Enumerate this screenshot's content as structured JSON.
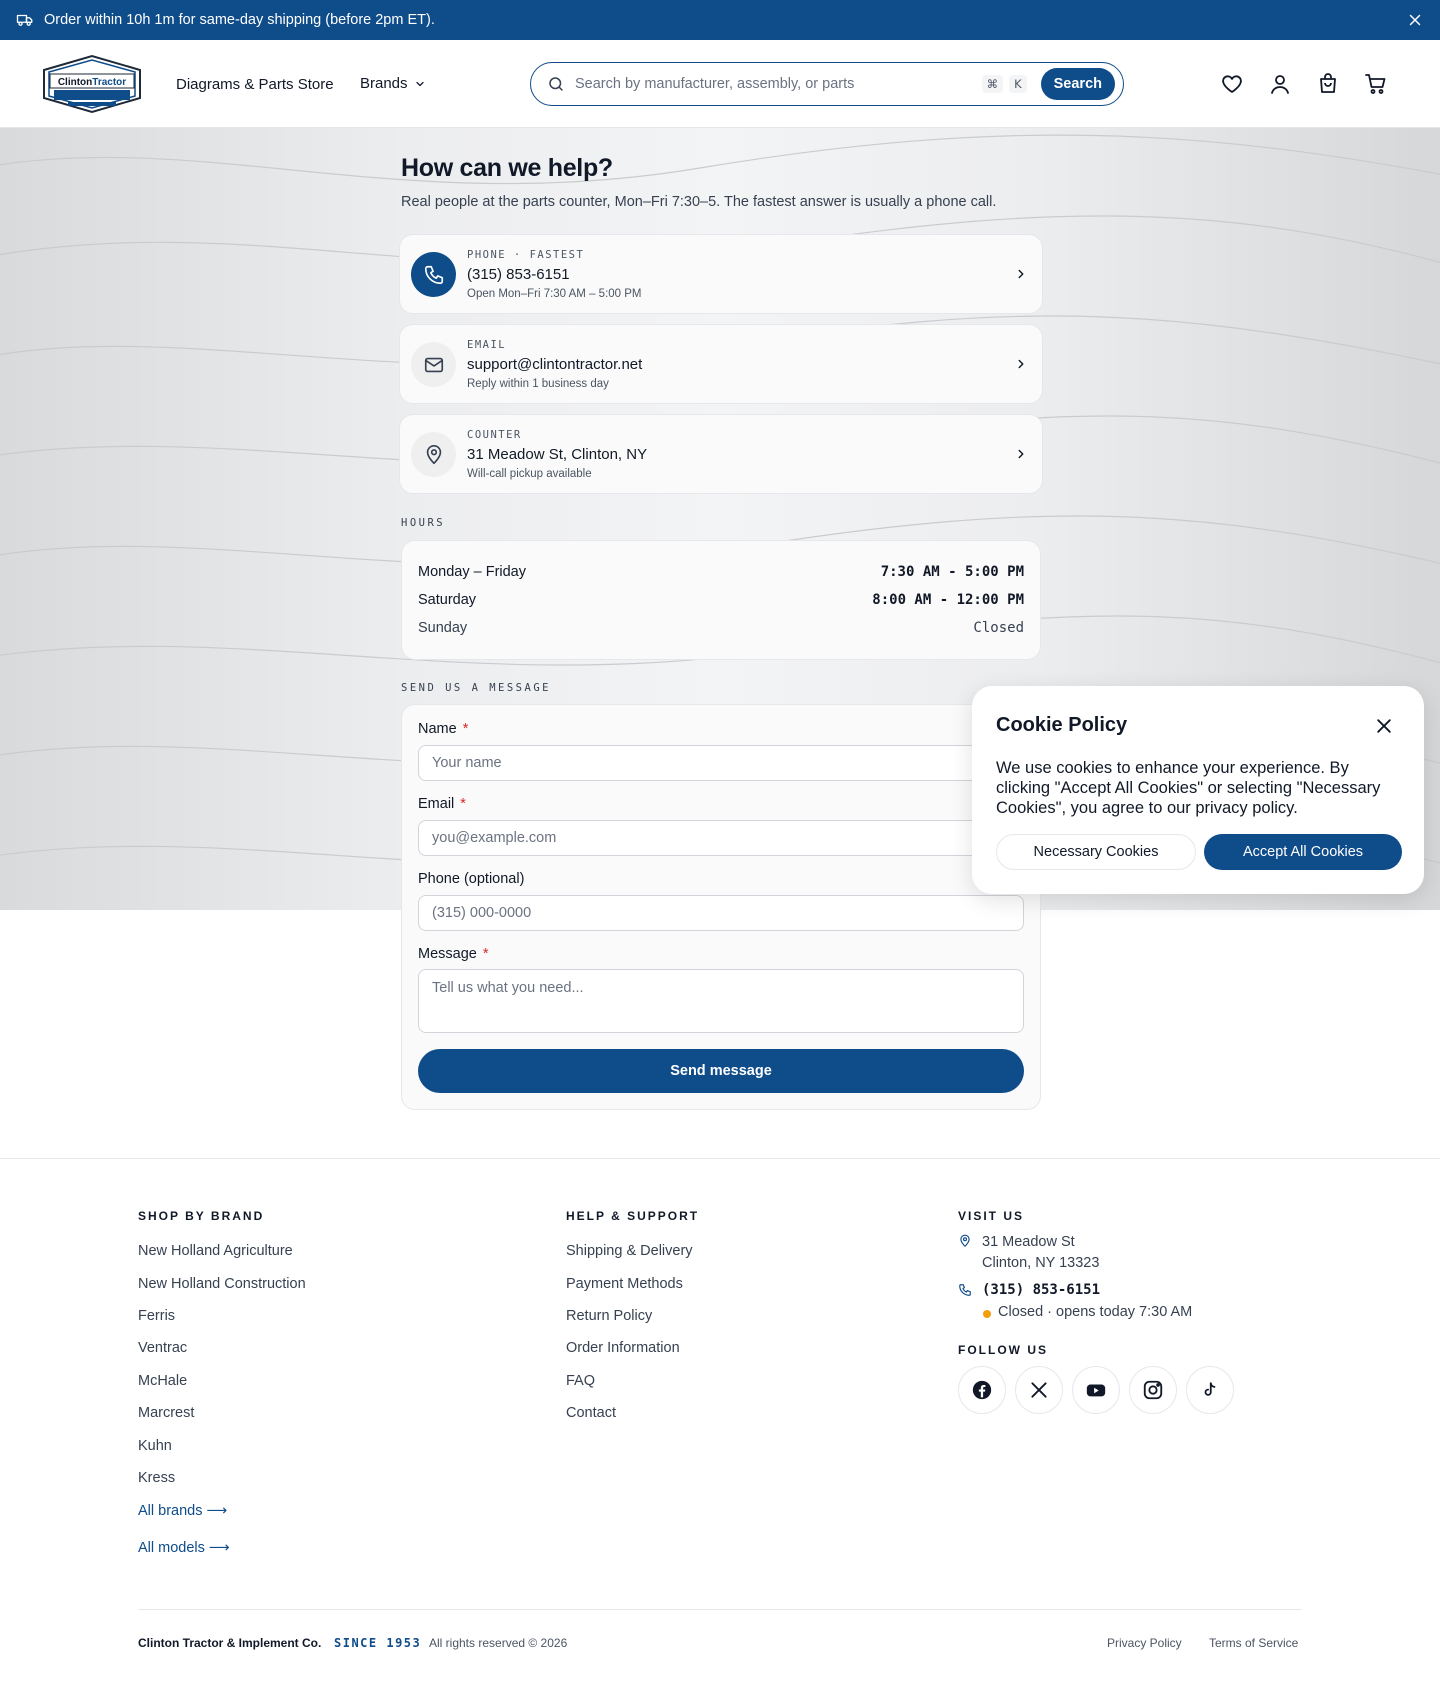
{
  "announcement": {
    "text": "Order within 10h 1m for same-day shipping (before 2pm ET).",
    "icon": "truck-icon",
    "close_icon": "close-icon"
  },
  "header": {
    "logo_text": "ClintonTractor",
    "nav": {
      "store": "Diagrams & Parts Store",
      "brands": "Brands"
    },
    "search": {
      "placeholder": "Search by manufacturer, assembly, or parts",
      "shortcut_cmd": "⌘",
      "shortcut_key": "K",
      "button_label": "Search"
    },
    "icons": [
      "heart-icon",
      "user-icon",
      "bag-icon",
      "cart-icon"
    ]
  },
  "hero": {
    "title": "How can we help?",
    "subtitle": "Real people at the parts counter, Mon–Fri 7:30–5. The fastest answer is usually a phone call."
  },
  "contact_cards": [
    {
      "label": "PHONE · FASTEST",
      "value": "(315) 853-6151",
      "sub": "Open Mon–Fri 7:30 AM – 5:00 PM",
      "icon": "phone-icon"
    },
    {
      "label": "EMAIL",
      "value": "support@clintontractor.net",
      "sub": "Reply within 1 business day",
      "icon": "mail-icon"
    },
    {
      "label": "COUNTER",
      "value": "31 Meadow St, Clinton, NY",
      "sub": "Will-call pickup available",
      "icon": "map-pin-icon"
    }
  ],
  "hours": {
    "label": "HOURS",
    "rows": [
      {
        "day": "Monday – Friday",
        "time": "7:30 AM - 5:00 PM"
      },
      {
        "day": "Saturday",
        "time": "8:00 AM - 12:00 PM"
      },
      {
        "day": "Sunday",
        "time": "Closed"
      }
    ]
  },
  "form": {
    "label": "SEND US A MESSAGE",
    "name_label": "Name",
    "name_placeholder": "Your name",
    "email_label": "Email",
    "email_placeholder": "you@example.com",
    "phone_label": "Phone (optional)",
    "phone_placeholder": "(315) 000-0000",
    "message_label": "Message",
    "message_placeholder": "Tell us what you need...",
    "required_mark": "*",
    "submit": "Send message"
  },
  "cookie": {
    "title": "Cookie Policy",
    "text": "We use cookies to enhance your experience. By clicking \"Accept All Cookies\" or selecting \"Necessary Cookies\", you agree to our privacy policy.",
    "necessary": "Necessary Cookies",
    "accept": "Accept All Cookies"
  },
  "footer": {
    "shop": {
      "heading": "SHOP BY BRAND",
      "links": [
        "New Holland Agriculture",
        "New Holland Construction",
        "Ferris",
        "Ventrac",
        "McHale",
        "Marcrest",
        "Kuhn",
        "Kress"
      ],
      "all_brands": "All brands ⟶",
      "all_models": "All models ⟶"
    },
    "help": {
      "heading": "HELP & SUPPORT",
      "links": [
        "Shipping & Delivery",
        "Payment Methods",
        "Return Policy",
        "Order Information",
        "FAQ",
        "Contact"
      ]
    },
    "visit": {
      "heading": "VISIT US",
      "address_line1": "31 Meadow St",
      "address_line2": "Clinton, NY 13323",
      "phone": "(315) 853-6151",
      "status": "Closed · opens today 7:30 AM",
      "status_color": "#f59e0b"
    },
    "follow": {
      "heading": "FOLLOW US",
      "icons": [
        "facebook-icon",
        "x-icon",
        "youtube-icon",
        "instagram-icon",
        "tiktok-icon"
      ]
    },
    "bottom": {
      "company": "Clinton Tractor & Implement Co.",
      "since": "SINCE 1953",
      "rights": "All rights reserved © 2026",
      "privacy": "Privacy Policy",
      "terms": "Terms of Service"
    }
  },
  "colors": {
    "brand": "#0f4c8a",
    "required": "#dc2626"
  }
}
